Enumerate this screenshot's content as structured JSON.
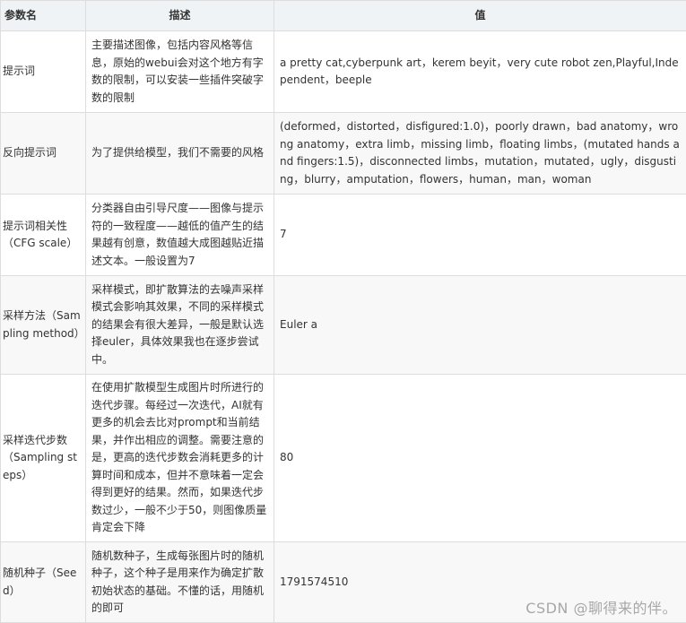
{
  "table": {
    "headers": [
      "参数名",
      "描述",
      "值"
    ],
    "rows": [
      {
        "name": "提示词",
        "description": "主要描述图像，包括内容风格等信息，原始的webui会对这个地方有字数的限制，可以安装一些插件突破字数的限制",
        "value": "a pretty cat,cyberpunk art，kerem beyit，very cute robot zen,Playful,Independent，beeple"
      },
      {
        "name": "反向提示词",
        "description": "为了提供给模型，我们不需要的风格",
        "value": "(deformed，distorted，disfigured:1.0)，poorly drawn，bad anatomy，wrong anatomy，extra limb，missing limb，floating limbs，(mutated hands and fingers:1.5)，disconnected limbs，mutation，mutated，ugly，disgusting，blurry，amputation，flowers，human，man，woman"
      },
      {
        "name": "提示词相关性（CFG scale）",
        "description": "分类器自由引导尺度——图像与提示符的一致程度——越低的值产生的结果越有创意，数值越大成图越贴近描述文本。一般设置为7",
        "value": "7"
      },
      {
        "name": "采样方法（Sampling method）",
        "description": "采样模式，即扩散算法的去噪声采样模式会影响其效果，不同的采样模式的结果会有很大差异，一般是默认选择euler，具体效果我也在逐步尝试中。",
        "value": "Euler a"
      },
      {
        "name": "采样迭代步数（Sampling steps）",
        "description": "在使用扩散模型生成图片时所进行的迭代步骤。每经过一次迭代，AI就有更多的机会去比对prompt和当前结果，并作出相应的调整。需要注意的是，更高的迭代步数会消耗更多的计算时间和成本，但并不意味着一定会得到更好的结果。然而，如果迭代步数过少，一般不少于50，则图像质量肯定会下降",
        "value": "80"
      },
      {
        "name": "随机种子（Seed）",
        "description": "随机数种子，生成每张图片时的随机种子，这个种子是用来作为确定扩散初始状态的基础。不懂的话，用随机的即可",
        "value": "1791574510"
      }
    ]
  },
  "watermark": "CSDN @聊得来的伴。"
}
